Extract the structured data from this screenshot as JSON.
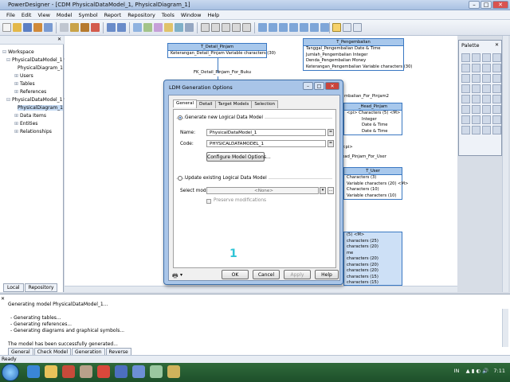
{
  "app": {
    "title": "PowerDesigner - [CDM PhysicalDataModel_1, PhysicalDiagram_1]"
  },
  "menu": [
    "File",
    "Edit",
    "View",
    "Model",
    "Symbol",
    "Report",
    "Repository",
    "Tools",
    "Window",
    "Help"
  ],
  "browser": {
    "items": [
      {
        "label": "Workspace",
        "level": 0
      },
      {
        "label": "PhysicalDataModel_1 *",
        "level": 1
      },
      {
        "label": "PhysicalDiagram_1",
        "level": 2
      },
      {
        "label": "Users",
        "level": 2
      },
      {
        "label": "Tables",
        "level": 2
      },
      {
        "label": "References",
        "level": 2
      },
      {
        "label": "PhysicalDataModel_1 *",
        "level": 1
      },
      {
        "label": "PhysicalDiagram_1",
        "level": 2
      },
      {
        "label": "Data Items",
        "level": 2
      },
      {
        "label": "Entities",
        "level": 2
      },
      {
        "label": "Relationships",
        "level": 2
      }
    ],
    "tabs": [
      "Local",
      "Repository"
    ]
  },
  "diagram": {
    "detail_pinjam": {
      "title": "T_Detail_Pinjam",
      "rows": [
        "Keterangan_Detail_Pinjam  Variable characters (30)"
      ]
    },
    "fk_label": "FK_Detail_Pinjam_For_Buku",
    "pengembalian": {
      "title": "T_Pengembalian",
      "rows": [
        "Tanggal_Pengembalian     Date & Time",
        "Jumlah_Pengembalian      Integer",
        "Denda_Pengembalian       Money",
        "Keterangan_Pengembalian  Variable characters (30)"
      ]
    },
    "fk_label2": "mbalian_For_Pinjam2",
    "head_pinjam": {
      "title": "_Head_Pinjam",
      "rows": [
        "<pi>  Characters (5)  <M>",
        "Integer",
        "Date & Time",
        "Date & Time"
      ],
      "footer": "<pi>"
    },
    "fk_label3": "ead_Pinjam_For_User",
    "user": {
      "title": "T_User",
      "rows": [
        "Characters (3)",
        "Variable characters (20)  <M>",
        "Characters (10)",
        "Variable characters (10)"
      ]
    },
    "bottom": {
      "rows": [
        "(5)  <M>",
        "characters (25)",
        "characters (20)",
        "me",
        "characters (20)",
        "characters (20)",
        "characters (20)",
        "characters (15)",
        "characters (15)"
      ]
    }
  },
  "palette": {
    "title": "Palette"
  },
  "dialog": {
    "title": "LDM Generation Options",
    "tabs": [
      "General",
      "Detail",
      "Target Models",
      "Selection"
    ],
    "generate_new_label": "Generate new Logical Data Model",
    "name_label": "Name:",
    "name_value": "PhysicalDataModel_1",
    "code_label": "Code:",
    "code_value": "PHYSICALDATAMODEL_1",
    "configure_label": "Configure Model Options...",
    "update_label": "Update existing Logical Data Model",
    "select_model_label": "Select model:",
    "select_model_value": "<None>",
    "preserve_label": "Preserve modifications",
    "buttons": {
      "ok": "OK",
      "cancel": "Cancel",
      "apply": "Apply",
      "help": "Help"
    }
  },
  "marker": "1",
  "output": {
    "lines": [
      "Generating model PhysicalDataModel_1...",
      "",
      "- Generating tables...",
      "- Generating references...",
      "- Generating diagrams and graphical symbols...",
      "",
      "The model has been successfully generated..."
    ],
    "tabs": [
      "General",
      "Check Model",
      "Generation",
      "Reverse"
    ]
  },
  "status": "Ready",
  "taskbar": {
    "lang": "IN",
    "time": "7:11"
  }
}
